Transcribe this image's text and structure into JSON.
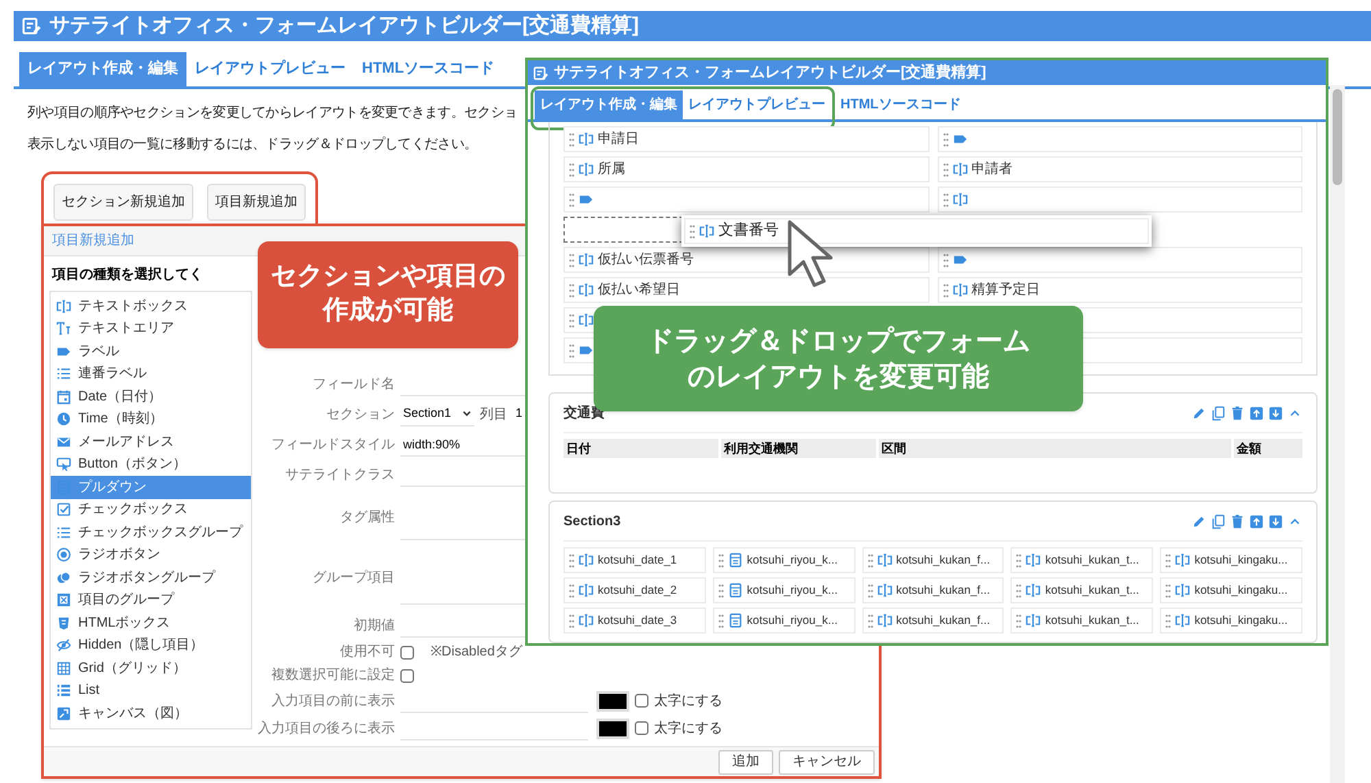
{
  "main_window": {
    "title": "サテライトオフィス・フォームレイアウトビルダー[交通費精算]",
    "tabs": [
      {
        "label": "レイアウト作成・編集",
        "selected": true
      },
      {
        "label": "レイアウトプレビュー",
        "selected": false
      },
      {
        "label": "HTMLソースコード",
        "selected": false
      }
    ],
    "description": [
      "列や項目の順序やセクションを変更してからレイアウトを変更できます。セクショ",
      "表示しない項目の一覧に移動するには、ドラッグ＆ドロップしてください。"
    ],
    "buttons": [
      "セクション新規追加",
      "項目新規追加"
    ]
  },
  "dialog": {
    "title": "項目新規追加",
    "list_heading": "項目の種類を選択してく",
    "item_types": [
      {
        "kind": "textbox",
        "label": "テキストボックス",
        "selected": false
      },
      {
        "kind": "textarea",
        "label": "テキストエリア",
        "selected": false
      },
      {
        "kind": "label",
        "label": "ラベル",
        "selected": false
      },
      {
        "kind": "numbered_label",
        "label": "連番ラベル",
        "selected": false
      },
      {
        "kind": "date",
        "label": "Date（日付）",
        "selected": false
      },
      {
        "kind": "time",
        "label": "Time（時刻）",
        "selected": false
      },
      {
        "kind": "mail",
        "label": "メールアドレス",
        "selected": false
      },
      {
        "kind": "button",
        "label": "Button（ボタン）",
        "selected": false
      },
      {
        "kind": "pulldown",
        "label": "プルダウン",
        "selected": true
      },
      {
        "kind": "checkbox",
        "label": "チェックボックス",
        "selected": false
      },
      {
        "kind": "checkbox_group",
        "label": "チェックボックスグループ",
        "selected": false
      },
      {
        "kind": "radio",
        "label": "ラジオボタン",
        "selected": false
      },
      {
        "kind": "radio_group",
        "label": "ラジオボタングループ",
        "selected": false
      },
      {
        "kind": "group",
        "label": "項目のグループ",
        "selected": false
      },
      {
        "kind": "html",
        "label": "HTMLボックス",
        "selected": false
      },
      {
        "kind": "hidden",
        "label": "Hidden（隠し項目）",
        "selected": false
      },
      {
        "kind": "grid",
        "label": "Grid（グリッド）",
        "selected": false
      },
      {
        "kind": "list",
        "label": "List",
        "selected": false
      },
      {
        "kind": "canvas",
        "label": "キャンバス（図）",
        "selected": false
      }
    ],
    "fields": [
      {
        "kind": "text",
        "label": "フィールド名"
      },
      {
        "kind": "section",
        "label": "セクション",
        "value": "Section1",
        "column_label": "列目",
        "column_value": "1"
      },
      {
        "kind": "text",
        "label": "フィールドスタイル",
        "value": "width:90%"
      },
      {
        "kind": "text",
        "label": "サテライトクラス"
      },
      {
        "kind": "textarea",
        "label": "タグ属性"
      },
      {
        "kind": "group",
        "label": "グループ項目"
      },
      {
        "kind": "text",
        "label": "初期値"
      },
      {
        "kind": "checkbox",
        "label": "使用不可",
        "checked": false,
        "note": "※Disabledタグ"
      },
      {
        "kind": "checkbox",
        "label": "複数選択可能に設定",
        "checked": false
      },
      {
        "kind": "color",
        "label": "入力項目の前に表示",
        "color": "#000000",
        "bold_label": "太字にする",
        "bold": false
      },
      {
        "kind": "color",
        "label": "入力項目の後ろに表示",
        "color": "#000000",
        "bold_label": "太字にする",
        "bold": false
      }
    ],
    "buttons": [
      "追加",
      "キャンセル"
    ]
  },
  "preview_window": {
    "title": "サテライトオフィス・フォームレイアウトビルダー[交通費精算]",
    "tabs": [
      {
        "label": "レイアウト作成・編集",
        "selected": true
      },
      {
        "label": "レイアウトプレビュー",
        "selected": false
      },
      {
        "label": "HTMLソースコード",
        "selected": false
      }
    ],
    "form_rows": [
      [
        {
          "kind": "textbox",
          "label": "申請日"
        },
        {
          "kind": "label"
        }
      ],
      [
        {
          "kind": "textbox",
          "label": "所属"
        },
        {
          "kind": "textbox",
          "label": "申請者"
        }
      ],
      [
        {
          "kind": "label"
        },
        {
          "kind": "textbox"
        }
      ],
      [
        {
          "kind": "placeholder"
        }
      ],
      [
        {
          "kind": "textbox",
          "label": "仮払い伝票番号"
        },
        {
          "kind": "label"
        }
      ],
      [
        {
          "kind": "textbox",
          "label": "仮払い希望日"
        },
        {
          "kind": "textbox",
          "label": "精算予定日"
        }
      ],
      [
        {
          "kind": "textbox"
        },
        {
          "kind": "blank"
        }
      ],
      [
        {
          "kind": "label"
        },
        {
          "kind": "blank"
        }
      ]
    ],
    "drag_item": {
      "kind": "textbox",
      "label": "文書番号"
    },
    "sections": [
      {
        "kind": "table",
        "title": "交通費",
        "columns": [
          "日付",
          "利用交通機関",
          "区間",
          "金額"
        ]
      },
      {
        "kind": "grid",
        "title": "Section3",
        "rows": [
          [
            {
              "kind": "textbox",
              "label": "kotsuhi_date_1"
            },
            {
              "kind": "pulldown",
              "label": "kotsuhi_riyou_k..."
            },
            {
              "kind": "textbox",
              "label": "kotsuhi_kukan_f..."
            },
            {
              "kind": "textbox",
              "label": "kotsuhi_kukan_t..."
            },
            {
              "kind": "textbox",
              "label": "kotsuhi_kingaku..."
            }
          ],
          [
            {
              "kind": "textbox",
              "label": "kotsuhi_date_2"
            },
            {
              "kind": "pulldown",
              "label": "kotsuhi_riyou_k..."
            },
            {
              "kind": "textbox",
              "label": "kotsuhi_kukan_f..."
            },
            {
              "kind": "textbox",
              "label": "kotsuhi_kukan_t..."
            },
            {
              "kind": "textbox",
              "label": "kotsuhi_kingaku..."
            }
          ],
          [
            {
              "kind": "textbox",
              "label": "kotsuhi_date_3"
            },
            {
              "kind": "pulldown",
              "label": "kotsuhi_riyou_k..."
            },
            {
              "kind": "textbox",
              "label": "kotsuhi_kukan_f..."
            },
            {
              "kind": "textbox",
              "label": "kotsuhi_kukan_t..."
            },
            {
              "kind": "textbox",
              "label": "kotsuhi_kingaku..."
            }
          ]
        ]
      }
    ]
  },
  "callouts": [
    {
      "lines": [
        "セクションや項目の",
        "作成が可能"
      ],
      "color": "#d9513c"
    },
    {
      "lines": [
        "ドラッグ＆ドロップでフォーム",
        "のレイアウトを変更可能"
      ],
      "color": "#5aa55a"
    }
  ]
}
